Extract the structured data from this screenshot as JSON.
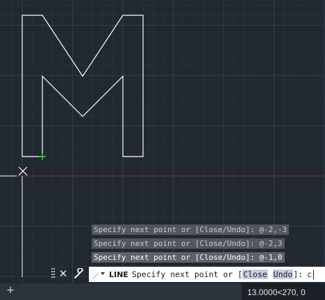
{
  "command_history": [
    "Specify next point or [Close/Undo]: @-2,-3",
    "Specify next point or [Close/Undo]: @-2,3",
    "Specify next point or [Close/Undo]: @-1,0"
  ],
  "command_line": {
    "command_name": "LINE",
    "prompt_text": "Specify next point or [",
    "option_close": "Close",
    "option_undo": "Undo",
    "prompt_suffix": "]:",
    "input_value": "c"
  },
  "status_bar": {
    "add_icon": "plus-icon",
    "coordinates": "13.0000<270, 0"
  },
  "icons": {
    "close": "close-icon",
    "customize": "wrench-icon",
    "recent_commands": "command-arrow-icon"
  },
  "colors": {
    "canvas": "#212830",
    "grid_minor": "#28303a",
    "grid_major": "#343c47",
    "drawn_lines": "#ffffff",
    "x_axis": "#7a2b33",
    "snap_marker": "#2bd52b"
  }
}
